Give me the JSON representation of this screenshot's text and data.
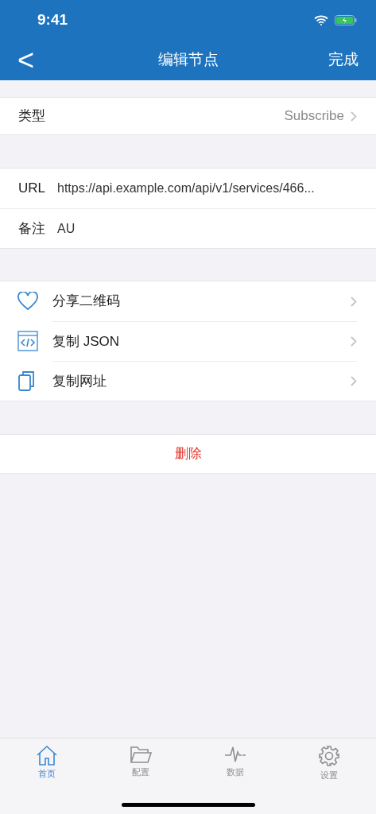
{
  "status_bar": {
    "time": "9:41"
  },
  "nav": {
    "back": "<",
    "title": "编辑节点",
    "done": "完成"
  },
  "type_row": {
    "label": "类型",
    "value": "Subscribe"
  },
  "fields": [
    {
      "label": "URL",
      "value": "https://api.example.com/api/v1/services/466..."
    },
    {
      "label": "备注",
      "value": "AU"
    }
  ],
  "actions": [
    {
      "kind": "heart",
      "label": "分享二维码"
    },
    {
      "kind": "code",
      "label": "复制 JSON"
    },
    {
      "kind": "copy",
      "label": "复制网址"
    }
  ],
  "delete": "删除",
  "tab_bar": [
    {
      "kind": "home",
      "label": "首页",
      "selected": true
    },
    {
      "kind": "folder",
      "label": "配置",
      "selected": false
    },
    {
      "kind": "pulse",
      "label": "数据",
      "selected": false
    },
    {
      "kind": "gear",
      "label": "设置",
      "selected": false
    }
  ]
}
